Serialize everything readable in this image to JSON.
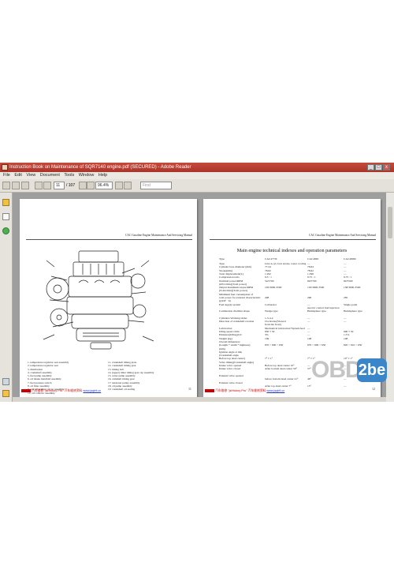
{
  "window": {
    "title": "Instruction Book on Maintenance of SQR7140 engine.pdf (SECURED) - Adobe Reader",
    "controls": [
      "_",
      "□",
      "x"
    ]
  },
  "menu": [
    "File",
    "Edit",
    "View",
    "Document",
    "Tools",
    "Window",
    "Help"
  ],
  "toolbar": {
    "page_current": "11",
    "page_total": "/ 107",
    "zoom": "96.4%",
    "search_placeholder": "Find"
  },
  "left_page": {
    "running_head": "CAC Gasoline Engine Maintenance And Servicing Manual",
    "figure_alt": "engine exploded drawing",
    "captions_col1": [
      "1.  temperature regulator seat assembly",
      "2.  temperature regulator seat",
      "3.  distribution",
      "4.  crankshaft assembly",
      "5.  fuel pump assembly",
      "6.  oil intake manifold assembly",
      "7.  fuel pressure switch",
      "8.  oil filter assembly",
      "9.  rear oil sealing carrier assembly",
      "10. oil collector assembly"
    ],
    "captions_col2": [
      "11. crankshaft timing plate",
      "12. crankshaft timing gear",
      "13. timing belt",
      "14. (upper) timer timing gear cap assembly",
      "15. water pump assembly",
      "16. camshaft timing gear",
      "17. tensioner pulley assembly",
      "18. oil pump assembly",
      "19. crankshaft oil sealing"
    ],
    "page_number": "11"
  },
  "right_page": {
    "running_head": "CAC Gasoline Engine Maintenance And Servicing Manual",
    "title": "Main engine technical indexes and operation parameters",
    "columns": [
      "Type",
      "CAC477JC",
      "CAC480C",
      "CAC480M"
    ],
    "rows": [
      [
        "Type",
        "Line 4-cyl, four stroke, water cooling",
        "—",
        "—"
      ],
      [
        "Cylinder bore diameter (mm)",
        "77.24",
        "78.84",
        "—"
      ],
      [
        "Stroke(mm)",
        "78.62",
        "78.62",
        "—"
      ],
      [
        "Total displacement(L)",
        "1.292",
        "1.596",
        "—"
      ],
      [
        "Compression ratio",
        "9.5 : 1",
        "9.75 : 1",
        "9.75 : 1"
      ],
      [
        "Nominal power/RPM",
        "54/5700",
        "60/5700",
        "82/5500"
      ],
      [
        "(kW/r/min)(Total power)",
        "",
        "",
        ""
      ],
      [
        "Output maximum torque/RPM",
        "105/3000-3500",
        "118/3000-3500",
        "138/3000-3500"
      ],
      [
        "(N.m/r/min)(Total power)",
        "",
        "",
        ""
      ],
      [
        "Minimum fuel consumption of",
        "",
        "",
        ""
      ],
      [
        "total power for external characteristic",
        "298",
        "290",
        "285"
      ],
      [
        "(g/kW · h)",
        "",
        "",
        ""
      ],
      [
        "Fuel supply system",
        "Carburetor",
        "—",
        "Single-point"
      ],
      [
        "",
        "",
        "electric control fuel injection",
        ""
      ],
      [
        "Combustion chamber shape",
        "Wedge type",
        "Hemisphere type",
        "Hemisphere type"
      ],
      [
        "",
        "",
        "",
        ""
      ],
      [
        "Cylinders Working Order",
        "1-3-4-2",
        "—",
        "—"
      ],
      [
        "Direction of crankshaft rotation",
        "Clockwise(Viewed",
        "—",
        "—"
      ],
      [
        "",
        "from the front)",
        "",
        ""
      ],
      [
        "Lubrication",
        "Mechanical lubrication+Splash feed",
        "—",
        ""
      ],
      [
        "Idling speed r/min",
        "850 ± 50",
        "—",
        "900 ± 50"
      ],
      [
        "Emission(Idling)CO",
        "3%",
        "—",
        "1.5%"
      ],
      [
        "Weight (kg)",
        "109",
        "108",
        "108"
      ],
      [
        "Overall dimension:",
        "",
        "",
        ""
      ],
      [
        "(Length * width * highness)",
        "870 × 600 × 650",
        "870 × 600 × 650",
        "820 × 610 × 650"
      ],
      [
        "(mm)",
        "",
        "",
        ""
      ],
      [
        "Ignition angle at idle",
        "",
        "",
        ""
      ],
      [
        "(Crankshaft angle",
        "",
        "",
        ""
      ],
      [
        "Before top dead center)",
        "7° ± 1°",
        "7° ± 1°",
        "10° ± 1°"
      ],
      [
        "Valve timing(Crankshaft angle)",
        "",
        "",
        ""
      ],
      [
        "Intake valve opened",
        "Before top dead center 10°",
        "—",
        "—"
      ],
      [
        "Intake valve closed",
        "After bottom dead center 50°",
        "57°",
        "—"
      ],
      [
        "",
        "",
        "",
        ""
      ],
      [
        "Exhaust valve opened",
        "",
        "",
        ""
      ],
      [
        "",
        "before bottom dead center 41°",
        "46°",
        "—"
      ],
      [
        "Exhaust valve closed",
        "",
        "",
        ""
      ],
      [
        "",
        "After top dead center 7°",
        "15°",
        "—"
      ]
    ],
    "page_number": "12"
  },
  "footer": {
    "left_text": "汽车维修 \"jsHistory Pro\" 汽车维修资料",
    "url": "www.jsqirit.cc"
  },
  "watermark": {
    "text": "OBD",
    "badge": "2be"
  }
}
